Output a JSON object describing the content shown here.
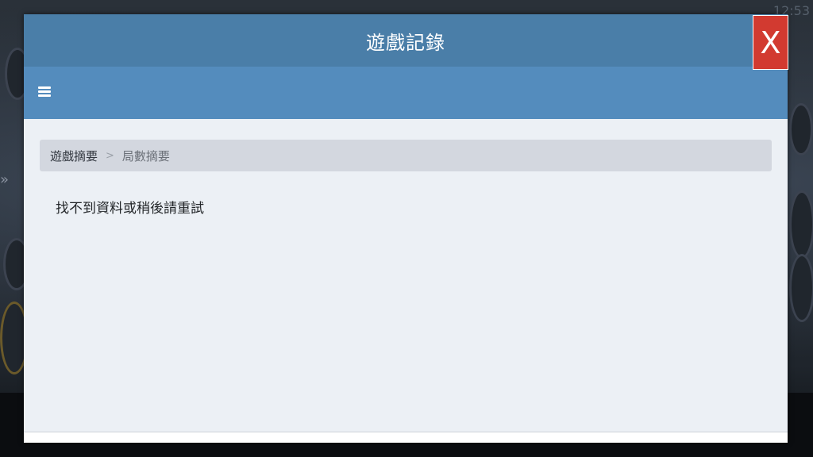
{
  "background": {
    "time_text": "12:53"
  },
  "modal": {
    "title": "遊戲記錄",
    "close_label": "X",
    "menu_icon": "hamburger-menu-icon",
    "breadcrumb": {
      "parent": "遊戲摘要",
      "separator": ">",
      "current": "局數摘要"
    },
    "message": "找不到資料或稍後請重試"
  },
  "colors": {
    "header": "#4a7ea8",
    "nav": "#548cbd",
    "close": "#d23a30",
    "content_bg": "#ecf0f5"
  }
}
